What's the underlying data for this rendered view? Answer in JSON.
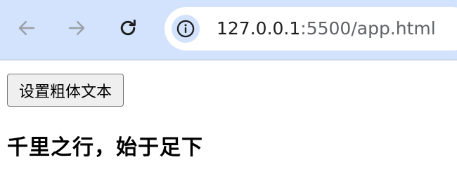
{
  "browser": {
    "url_host": "127.0.0.1",
    "url_rest": ":5500/app.html"
  },
  "page": {
    "button_label": "设置粗体文本",
    "text": "千里之行，始于足下"
  }
}
